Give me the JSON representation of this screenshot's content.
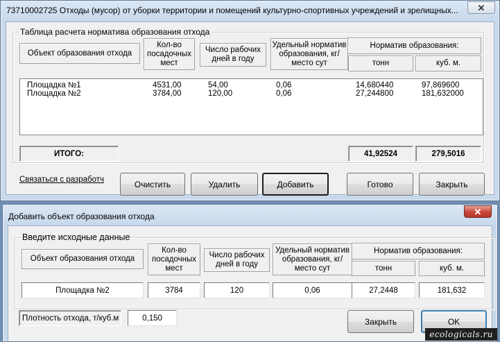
{
  "main_window": {
    "title": "73710002725 Отходы (мусор) от уборки территории и помещений культурно-спортивных учреждений и зрелищных...",
    "close_glyph": "✕",
    "group_label": "Таблица расчета норматива образования отхода",
    "headers": {
      "object": "Объект образования отхода",
      "seats": "Кол-во посадочных мест",
      "days": "Число рабочих дней в году",
      "specific": "Удельный норматив образования, кг/место сут",
      "norm": "Норматив образования:",
      "tons": "тонн",
      "cubic": "куб. м."
    },
    "rows": [
      {
        "object": "Площадка №1",
        "seats": "4531,00",
        "days": "54,00",
        "specific": "0,06",
        "tons": "14,680440",
        "cubic": "97,869600"
      },
      {
        "object": "Площадка №2",
        "seats": "3784,00",
        "days": "120,00",
        "specific": "0,06",
        "tons": "27,244800",
        "cubic": "181,632000"
      }
    ],
    "total_label": "ИТОГО:",
    "total_tons": "41,92524",
    "total_cubic": "279,5016",
    "contact_link": "Связаться с разработч",
    "buttons": {
      "clear": "Очистить",
      "delete": "Удалить",
      "add": "Добавить",
      "done": "Готово",
      "close": "Закрыть"
    }
  },
  "dialog": {
    "title": "Добавить объект образования отхода",
    "close_glyph": "✕",
    "group_label": "Введите исходные данные",
    "headers": {
      "object": "Объект образования отхода",
      "seats": "Кол-во посадочных мест",
      "days": "Число рабочих дней в году",
      "specific": "Удельный норматив образования, кг/место сут",
      "norm": "Норматив образования:",
      "tons": "тонн",
      "cubic": "куб. м."
    },
    "inputs": {
      "object": "Площадка №2",
      "seats": "3784",
      "days": "120",
      "specific": "0,06",
      "tons": "27,2448",
      "cubic": "181,632"
    },
    "density_label": "Плотность отхода, т/куб.м",
    "density_value": "0,150",
    "buttons": {
      "close": "Закрыть",
      "ok": "OK"
    }
  },
  "watermark": "ecologicals.ru"
}
